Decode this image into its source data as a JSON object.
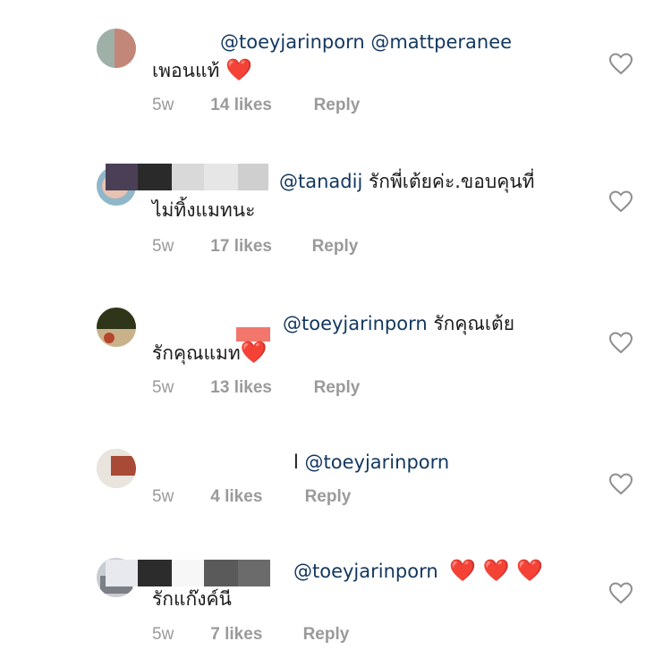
{
  "comments": [
    {
      "username": "",
      "mentions": "@toeyjarinporn @mattperanee",
      "text": "เพอนแท้",
      "hearts": "❤️",
      "time": "5w",
      "likes": "14 likes",
      "reply": "Reply"
    },
    {
      "username": "",
      "mention": "@tanadij",
      "text1": "รักพี่เต้ยค่ะ.ขอบคุนที่",
      "text2": "ไม่ทิ้งแมทนะ",
      "time": "5w",
      "likes": "17 likes",
      "reply": "Reply"
    },
    {
      "username": "",
      "mention": "@toeyjarinporn",
      "text1": "รักคุณเต้ย",
      "text2": "รักคุณแมท",
      "hearts": "❤️",
      "time": "5w",
      "likes": "13 likes",
      "reply": "Reply"
    },
    {
      "username_tail": "l",
      "mention": "@toeyjarinporn",
      "time": "5w",
      "likes": "4 likes",
      "reply": "Reply"
    },
    {
      "username": "",
      "mention": "@toeyjarinporn",
      "hearts": "❤️ ❤️ ❤️",
      "text": "รักแก๊งค์นี",
      "time": "5w",
      "likes": "7 likes",
      "reply": "Reply"
    }
  ],
  "icons": {
    "like": "heart-outline-icon"
  },
  "colors": {
    "mention": "#12375f",
    "meta": "#9a9a9a",
    "heart": "#e0141e"
  }
}
